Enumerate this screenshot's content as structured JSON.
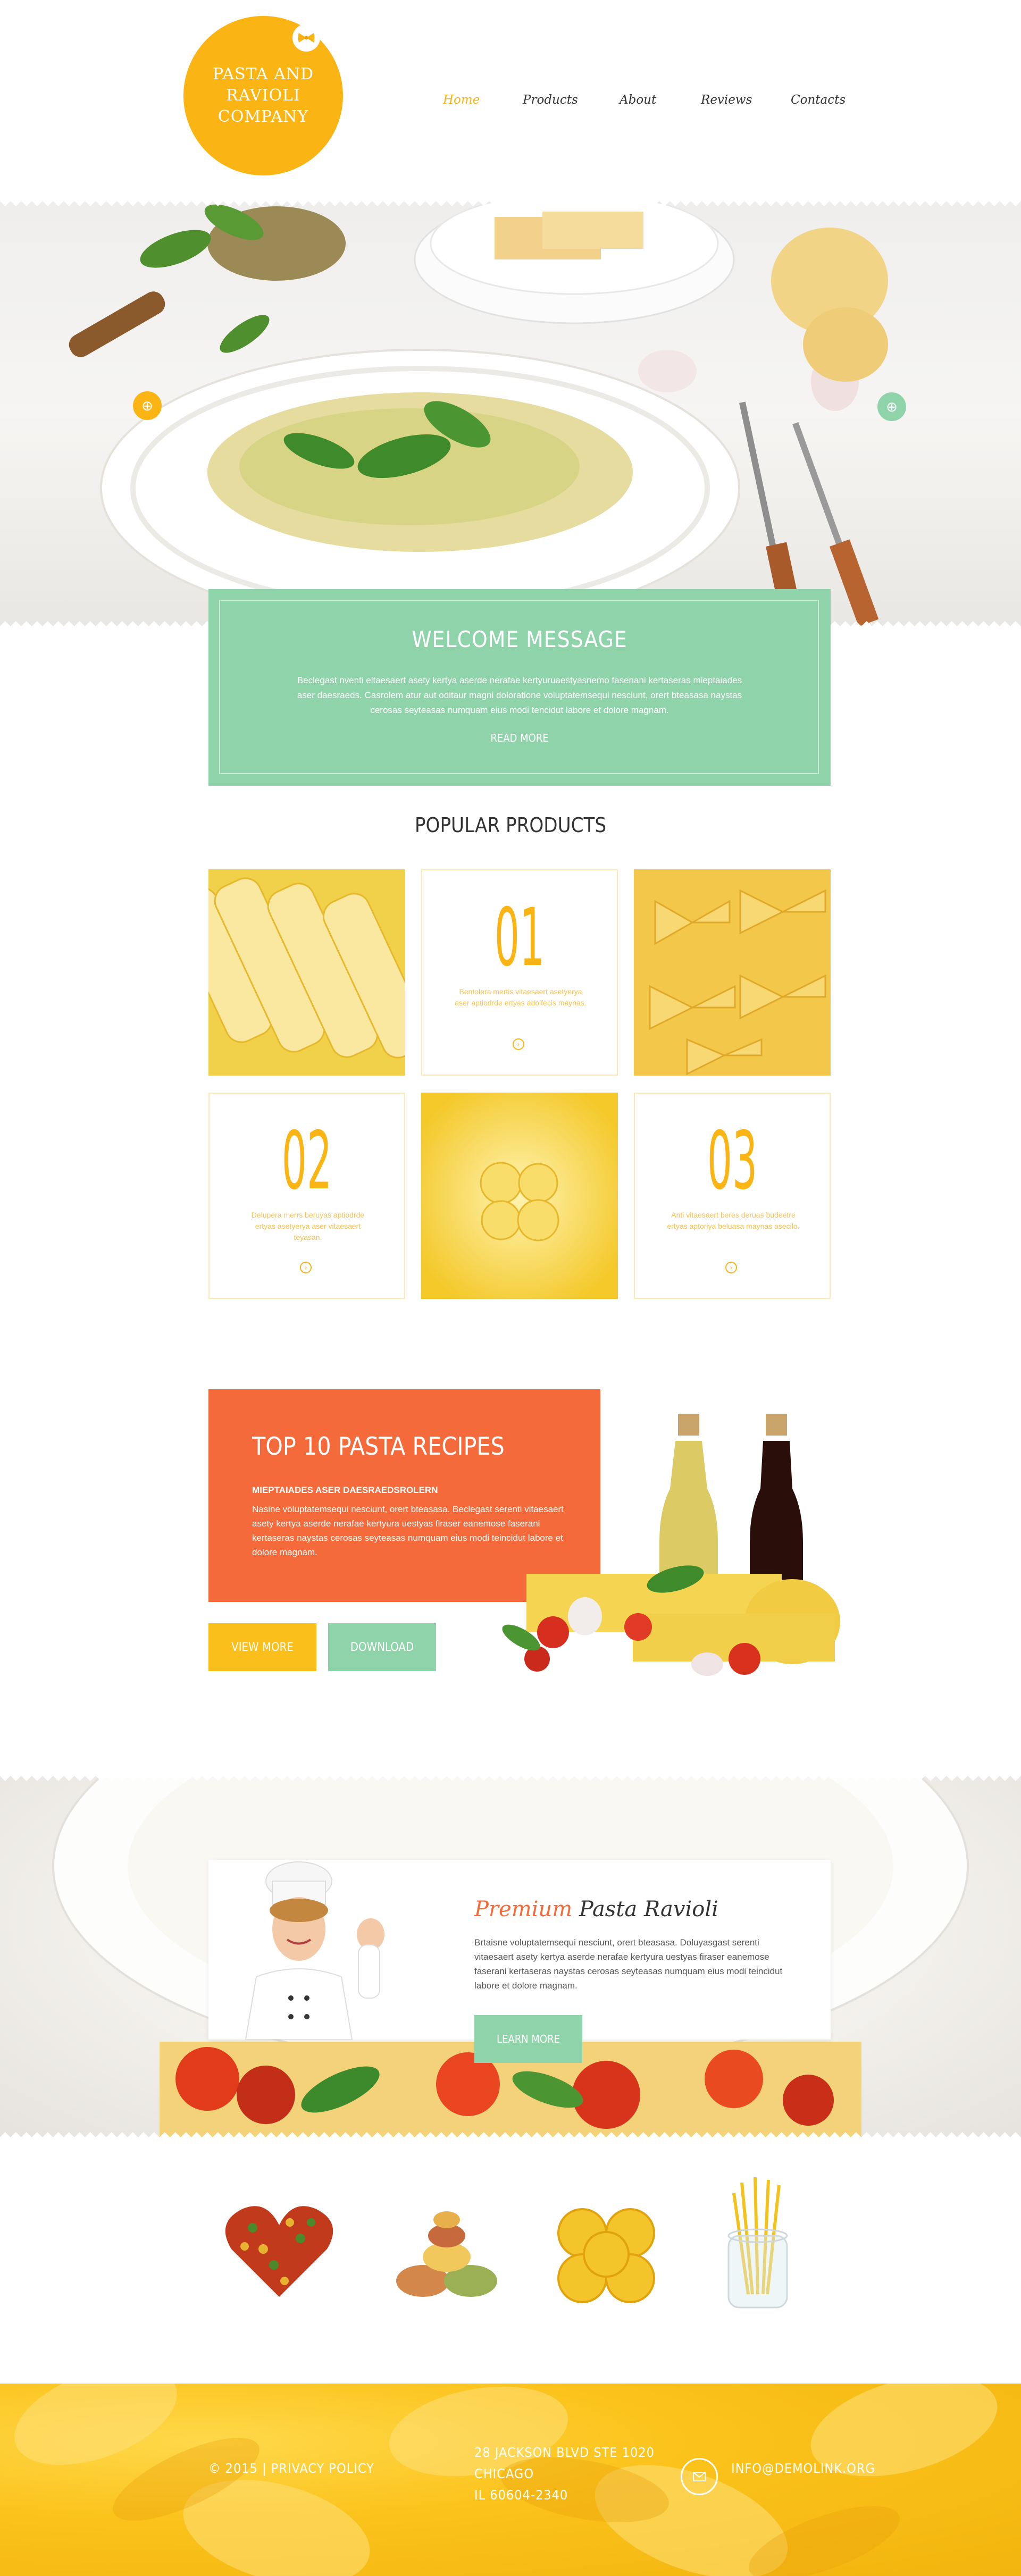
{
  "header": {
    "logo_text": "PASTA AND RAVIOLI COMPANY",
    "nav": [
      {
        "label": "Home",
        "active": true
      },
      {
        "label": "Products",
        "active": false
      },
      {
        "label": "About",
        "active": false
      },
      {
        "label": "Reviews",
        "active": false
      },
      {
        "label": "Contacts",
        "active": false
      }
    ]
  },
  "hero": {
    "prev_icon": "arrow-circle-icon",
    "next_icon": "arrow-circle-icon"
  },
  "welcome": {
    "title": "WELCOME MESSAGE",
    "body": "Beclegast nventi eltaesaert asety kertya aserde nerafae kertyuruaestyasnemo fasenani kertaseras mieptaiades aser daesraeds. Casrolem atur aut oditaur magni doloratione voluptatemsequi nesciunt, orert bteasasa naystas cerosas seyteasas numquam eius modi tencidut labore et dolore magnam.",
    "more": "READ MORE"
  },
  "popular": {
    "title": "POPULAR PRODUCTS",
    "cards": [
      {
        "num": "01",
        "text": "Bentolera mertis vitaesaert asetyerya aser aptiodrde ertyas adoifecis maynas."
      },
      {
        "num": "02",
        "text": "Delupera merrs beruyas aptiodrde ertyas asetyerya aser vitaesaert teyasan."
      },
      {
        "num": "03",
        "text": "Anti vitaesaert beres deruas budeetre ertyas aptoriya beluasa maynas asecilo."
      }
    ]
  },
  "recipes": {
    "title": "TOP 10 PASTA RECIPES",
    "subtitle": "MIEPTAIADES ASER DAESRAEDSROLERN",
    "body": "Nasine voluptatemsequi nesciunt, orert bteasasa. Beclegast serenti vitaesaert asety kertya aserde nerafae kertyura uestyas firaser eanemose  faserani kertaseras naystas cerosas seyteasas numquam eius modi teincidut labore et dolore magnam.",
    "view_more": "VIEW MORE",
    "download": "DOWNLOAD"
  },
  "premium": {
    "title_accent": "Premium",
    "title_rest": "Pasta  Ravioli",
    "body": "Brtaisne voluptatemsequi nesciunt, orert bteasasa. Doluyasgast serenti vitaesaert asety kertya aserde nerafae kertyura uestyas firaser eanemose  faserani kertaseras naystas cerosas seyteasas numquam eius modi teincidut labore et dolore magnam.",
    "button": "LEARN MORE"
  },
  "footer": {
    "copyright": "© 2015 | PRIVACY POLICY",
    "address_1": "28 JACKSON BLVD STE 1020",
    "address_2": "CHICAGO",
    "address_3": "IL 60604-2340",
    "email": "INFO@DEMOLINK.ORG",
    "mail_icon": "mail-icon"
  },
  "colors": {
    "accent_yellow": "#fab514",
    "mint": "#8fd3aa",
    "orange": "#f56a3a"
  }
}
